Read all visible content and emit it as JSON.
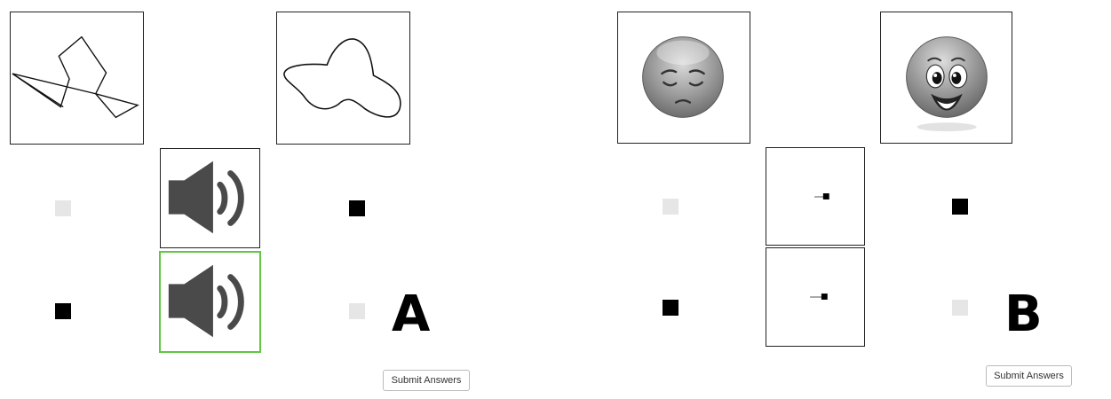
{
  "panel_a": {
    "label": "A",
    "submit_label": "Submit Answers",
    "stimulus_left": "line-drawing",
    "stimulus_right": "blob-drawing",
    "audio_top_icon": "speaker-icon",
    "audio_bottom_icon": "speaker-icon",
    "audio_bottom_selected": true
  },
  "panel_b": {
    "label": "B",
    "submit_label": "Submit Answers",
    "stimulus_left": "sad-face-icon",
    "stimulus_right": "happy-face-icon"
  },
  "colors": {
    "selected_border": "#5fc742",
    "speaker": "#4a4a4a",
    "inactive_square": "#e6e6e6",
    "active_square": "#000000"
  }
}
